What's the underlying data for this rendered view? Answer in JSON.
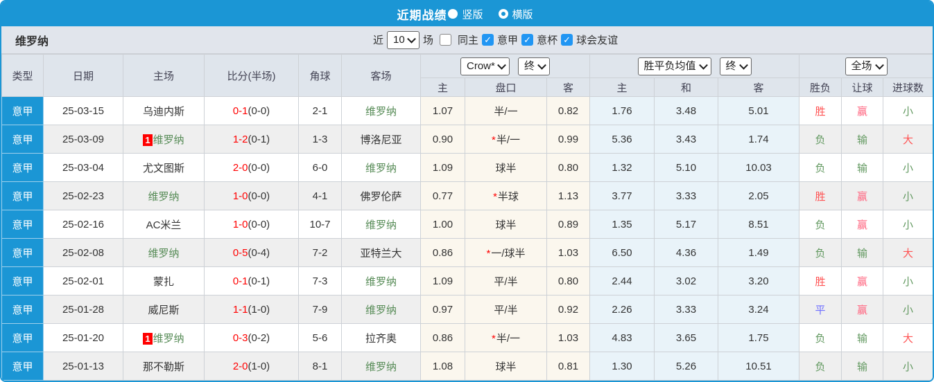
{
  "topbar": {
    "title": "近期战绩",
    "vertical_label": "竖版",
    "horizontal_label": "横版",
    "vertical_selected": true
  },
  "filter": {
    "team": "维罗纳",
    "near_label": "近",
    "count_value": "10",
    "games_label": "场",
    "same_home_label": "同主",
    "same_home_checked": false,
    "league_options": [
      {
        "label": "意甲",
        "checked": true
      },
      {
        "label": "意杯",
        "checked": true
      },
      {
        "label": "球会友谊",
        "checked": true
      }
    ]
  },
  "table": {
    "star_glyph": "*",
    "headers": {
      "type": "类型",
      "date": "日期",
      "home": "主场",
      "score": "比分(半场)",
      "corner": "角球",
      "away": "客场",
      "odds_home": "主",
      "handicap": "盘口",
      "odds_away": "客",
      "avg_win": "主",
      "avg_draw": "和",
      "avg_lose": "客",
      "result": "胜负",
      "spread": "让球",
      "goals": "进球数"
    },
    "selects": {
      "odds_company": "Crow*",
      "odds_time": "终",
      "avg_name": "胜平负均值",
      "avg_time": "终",
      "scope": "全场"
    },
    "rows": [
      {
        "league": "意甲",
        "date": "25-03-15",
        "home": "乌迪内斯",
        "home_is_verona": false,
        "home_badge": "",
        "score_full": "0-1",
        "score_half": "(0-0)",
        "corners": "2-1",
        "away": "维罗纳",
        "away_is_verona": true,
        "odds_home": "1.07",
        "handicap": "半/一",
        "handicap_star": false,
        "odds_away": "0.82",
        "avg_win": "1.76",
        "avg_draw": "3.48",
        "avg_lose": "5.01",
        "result": "胜",
        "spread": "赢",
        "goals": "小"
      },
      {
        "league": "意甲",
        "date": "25-03-09",
        "home": "维罗纳",
        "home_is_verona": true,
        "home_badge": "1",
        "score_full": "1-2",
        "score_half": "(0-1)",
        "corners": "1-3",
        "away": "博洛尼亚",
        "away_is_verona": false,
        "odds_home": "0.90",
        "handicap": "半/一",
        "handicap_star": true,
        "odds_away": "0.99",
        "avg_win": "5.36",
        "avg_draw": "3.43",
        "avg_lose": "1.74",
        "result": "负",
        "spread": "输",
        "goals": "大"
      },
      {
        "league": "意甲",
        "date": "25-03-04",
        "home": "尤文图斯",
        "home_is_verona": false,
        "home_badge": "",
        "score_full": "2-0",
        "score_half": "(0-0)",
        "corners": "6-0",
        "away": "维罗纳",
        "away_is_verona": true,
        "odds_home": "1.09",
        "handicap": "球半",
        "handicap_star": false,
        "odds_away": "0.80",
        "avg_win": "1.32",
        "avg_draw": "5.10",
        "avg_lose": "10.03",
        "result": "负",
        "spread": "输",
        "goals": "小"
      },
      {
        "league": "意甲",
        "date": "25-02-23",
        "home": "维罗纳",
        "home_is_verona": true,
        "home_badge": "",
        "score_full": "1-0",
        "score_half": "(0-0)",
        "corners": "4-1",
        "away": "佛罗伦萨",
        "away_is_verona": false,
        "odds_home": "0.77",
        "handicap": "半球",
        "handicap_star": true,
        "odds_away": "1.13",
        "avg_win": "3.77",
        "avg_draw": "3.33",
        "avg_lose": "2.05",
        "result": "胜",
        "spread": "赢",
        "goals": "小"
      },
      {
        "league": "意甲",
        "date": "25-02-16",
        "home": "AC米兰",
        "home_is_verona": false,
        "home_badge": "",
        "score_full": "1-0",
        "score_half": "(0-0)",
        "corners": "10-7",
        "away": "维罗纳",
        "away_is_verona": true,
        "odds_home": "1.00",
        "handicap": "球半",
        "handicap_star": false,
        "odds_away": "0.89",
        "avg_win": "1.35",
        "avg_draw": "5.17",
        "avg_lose": "8.51",
        "result": "负",
        "spread": "赢",
        "goals": "小"
      },
      {
        "league": "意甲",
        "date": "25-02-08",
        "home": "维罗纳",
        "home_is_verona": true,
        "home_badge": "",
        "score_full": "0-5",
        "score_half": "(0-4)",
        "corners": "7-2",
        "away": "亚特兰大",
        "away_is_verona": false,
        "odds_home": "0.86",
        "handicap": "一/球半",
        "handicap_star": true,
        "odds_away": "1.03",
        "avg_win": "6.50",
        "avg_draw": "4.36",
        "avg_lose": "1.49",
        "result": "负",
        "spread": "输",
        "goals": "大"
      },
      {
        "league": "意甲",
        "date": "25-02-01",
        "home": "蒙扎",
        "home_is_verona": false,
        "home_badge": "",
        "score_full": "0-1",
        "score_half": "(0-1)",
        "corners": "7-3",
        "away": "维罗纳",
        "away_is_verona": true,
        "odds_home": "1.09",
        "handicap": "平/半",
        "handicap_star": false,
        "odds_away": "0.80",
        "avg_win": "2.44",
        "avg_draw": "3.02",
        "avg_lose": "3.20",
        "result": "胜",
        "spread": "赢",
        "goals": "小"
      },
      {
        "league": "意甲",
        "date": "25-01-28",
        "home": "威尼斯",
        "home_is_verona": false,
        "home_badge": "",
        "score_full": "1-1",
        "score_half": "(1-0)",
        "corners": "7-9",
        "away": "维罗纳",
        "away_is_verona": true,
        "odds_home": "0.97",
        "handicap": "平/半",
        "handicap_star": false,
        "odds_away": "0.92",
        "avg_win": "2.26",
        "avg_draw": "3.33",
        "avg_lose": "3.24",
        "result": "平",
        "spread": "赢",
        "goals": "小"
      },
      {
        "league": "意甲",
        "date": "25-01-20",
        "home": "维罗纳",
        "home_is_verona": true,
        "home_badge": "1",
        "score_full": "0-3",
        "score_half": "(0-2)",
        "corners": "5-6",
        "away": "拉齐奥",
        "away_is_verona": false,
        "odds_home": "0.86",
        "handicap": "半/一",
        "handicap_star": true,
        "odds_away": "1.03",
        "avg_win": "4.83",
        "avg_draw": "3.65",
        "avg_lose": "1.75",
        "result": "负",
        "spread": "输",
        "goals": "大"
      },
      {
        "league": "意甲",
        "date": "25-01-13",
        "home": "那不勒斯",
        "home_is_verona": false,
        "home_badge": "",
        "score_full": "2-0",
        "score_half": "(1-0)",
        "corners": "8-1",
        "away": "维罗纳",
        "away_is_verona": true,
        "odds_home": "1.08",
        "handicap": "球半",
        "handicap_star": false,
        "odds_away": "0.81",
        "avg_win": "1.30",
        "avg_draw": "5.26",
        "avg_lose": "10.51",
        "result": "负",
        "spread": "输",
        "goals": "小"
      }
    ]
  },
  "colors": {
    "accent_blue": "#1b96d5",
    "team_green": "#568b56",
    "score_red": "#ff0000",
    "badge_red": "#ff0000",
    "result": {
      "胜": "#ff5252",
      "负": "#61985f",
      "平": "#6e6eff"
    },
    "spread": {
      "赢": "#ff6680",
      "输": "#61985f"
    },
    "goals": {
      "大": "#ff5252",
      "小": "#61985f"
    }
  }
}
